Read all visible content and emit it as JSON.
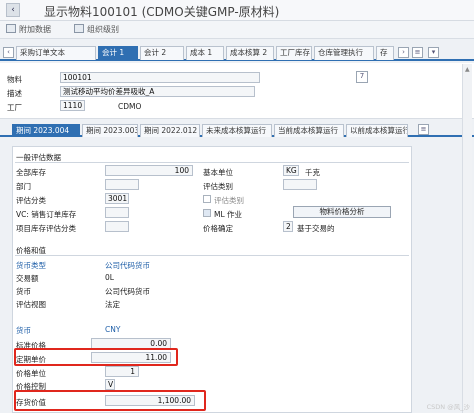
{
  "window": {
    "title": "显示物料100101 (CDMO关键GMP-原材料)"
  },
  "toolbar": {
    "additional_data": "附加数据",
    "org_levels": "组织级别"
  },
  "view_tabs": [
    "采购订单文本",
    "会计 1",
    "会计 2",
    "成本 1",
    "成本核算 2",
    "工厂库存",
    "仓库管理执行",
    "存"
  ],
  "header": {
    "material_label": "物料",
    "material_value": "100101",
    "desc_label": "描述",
    "desc_value": "测试移动平均价差异吸收_A",
    "plant_label": "工厂",
    "plant_value": "1110",
    "plant_desc": "CDMO"
  },
  "period_tabs": [
    "期间 2023.004",
    "期间 2023.003",
    "期间 2022.012",
    "未来成本核算运行",
    "当前成本核算运行",
    "以前成本核算运行"
  ],
  "general": {
    "section": "一般评估数据",
    "base_qty_label": "全部库存",
    "base_qty_value": "100",
    "base_unit_label": "基本单位",
    "base_unit_value": "KG",
    "base_unit_desc": "千克",
    "division_label": "部门",
    "valuation_type_label": "评估类别",
    "valuation_class_label": "评估分类",
    "valuation_class_value": "3001",
    "valuation_cat_label": "评估类别",
    "vc_label": "VC: 销售订单库存",
    "ml_label": "ML 作业",
    "proj_label": "项目库存评估分类",
    "price_det_label": "价格确定",
    "price_det_value": "2",
    "price_det_desc": "基于交易的",
    "mat_price_btn": "物料价格分析"
  },
  "prices": {
    "section": "价格和值",
    "currency_type_label": "货币类型",
    "currency_type_value": "公司代码货币",
    "curr_tab_label": "交易额",
    "curr_tab_value": "0L",
    "currency_label": "货币",
    "currency_value": "公司代码货币",
    "val_view_label": "评估视图",
    "val_view_value": "法定",
    "curr2_label": "货币",
    "curr2_value": "CNY",
    "std_price_label": "标准价格",
    "std_price_value": "0.00",
    "period_price_label": "定期单价",
    "period_price_value": "11.00",
    "price_unit_label": "价格单位",
    "price_unit_value": "1",
    "price_ctrl_label": "价格控制",
    "price_ctrl_value": "V",
    "inv_value_label": "存货价值",
    "inv_value_value": "1,100.00"
  },
  "watermark": "CSDN @风_沙",
  "colors": {
    "accent": "#2f6fb2",
    "highlight": "#e0271d"
  }
}
